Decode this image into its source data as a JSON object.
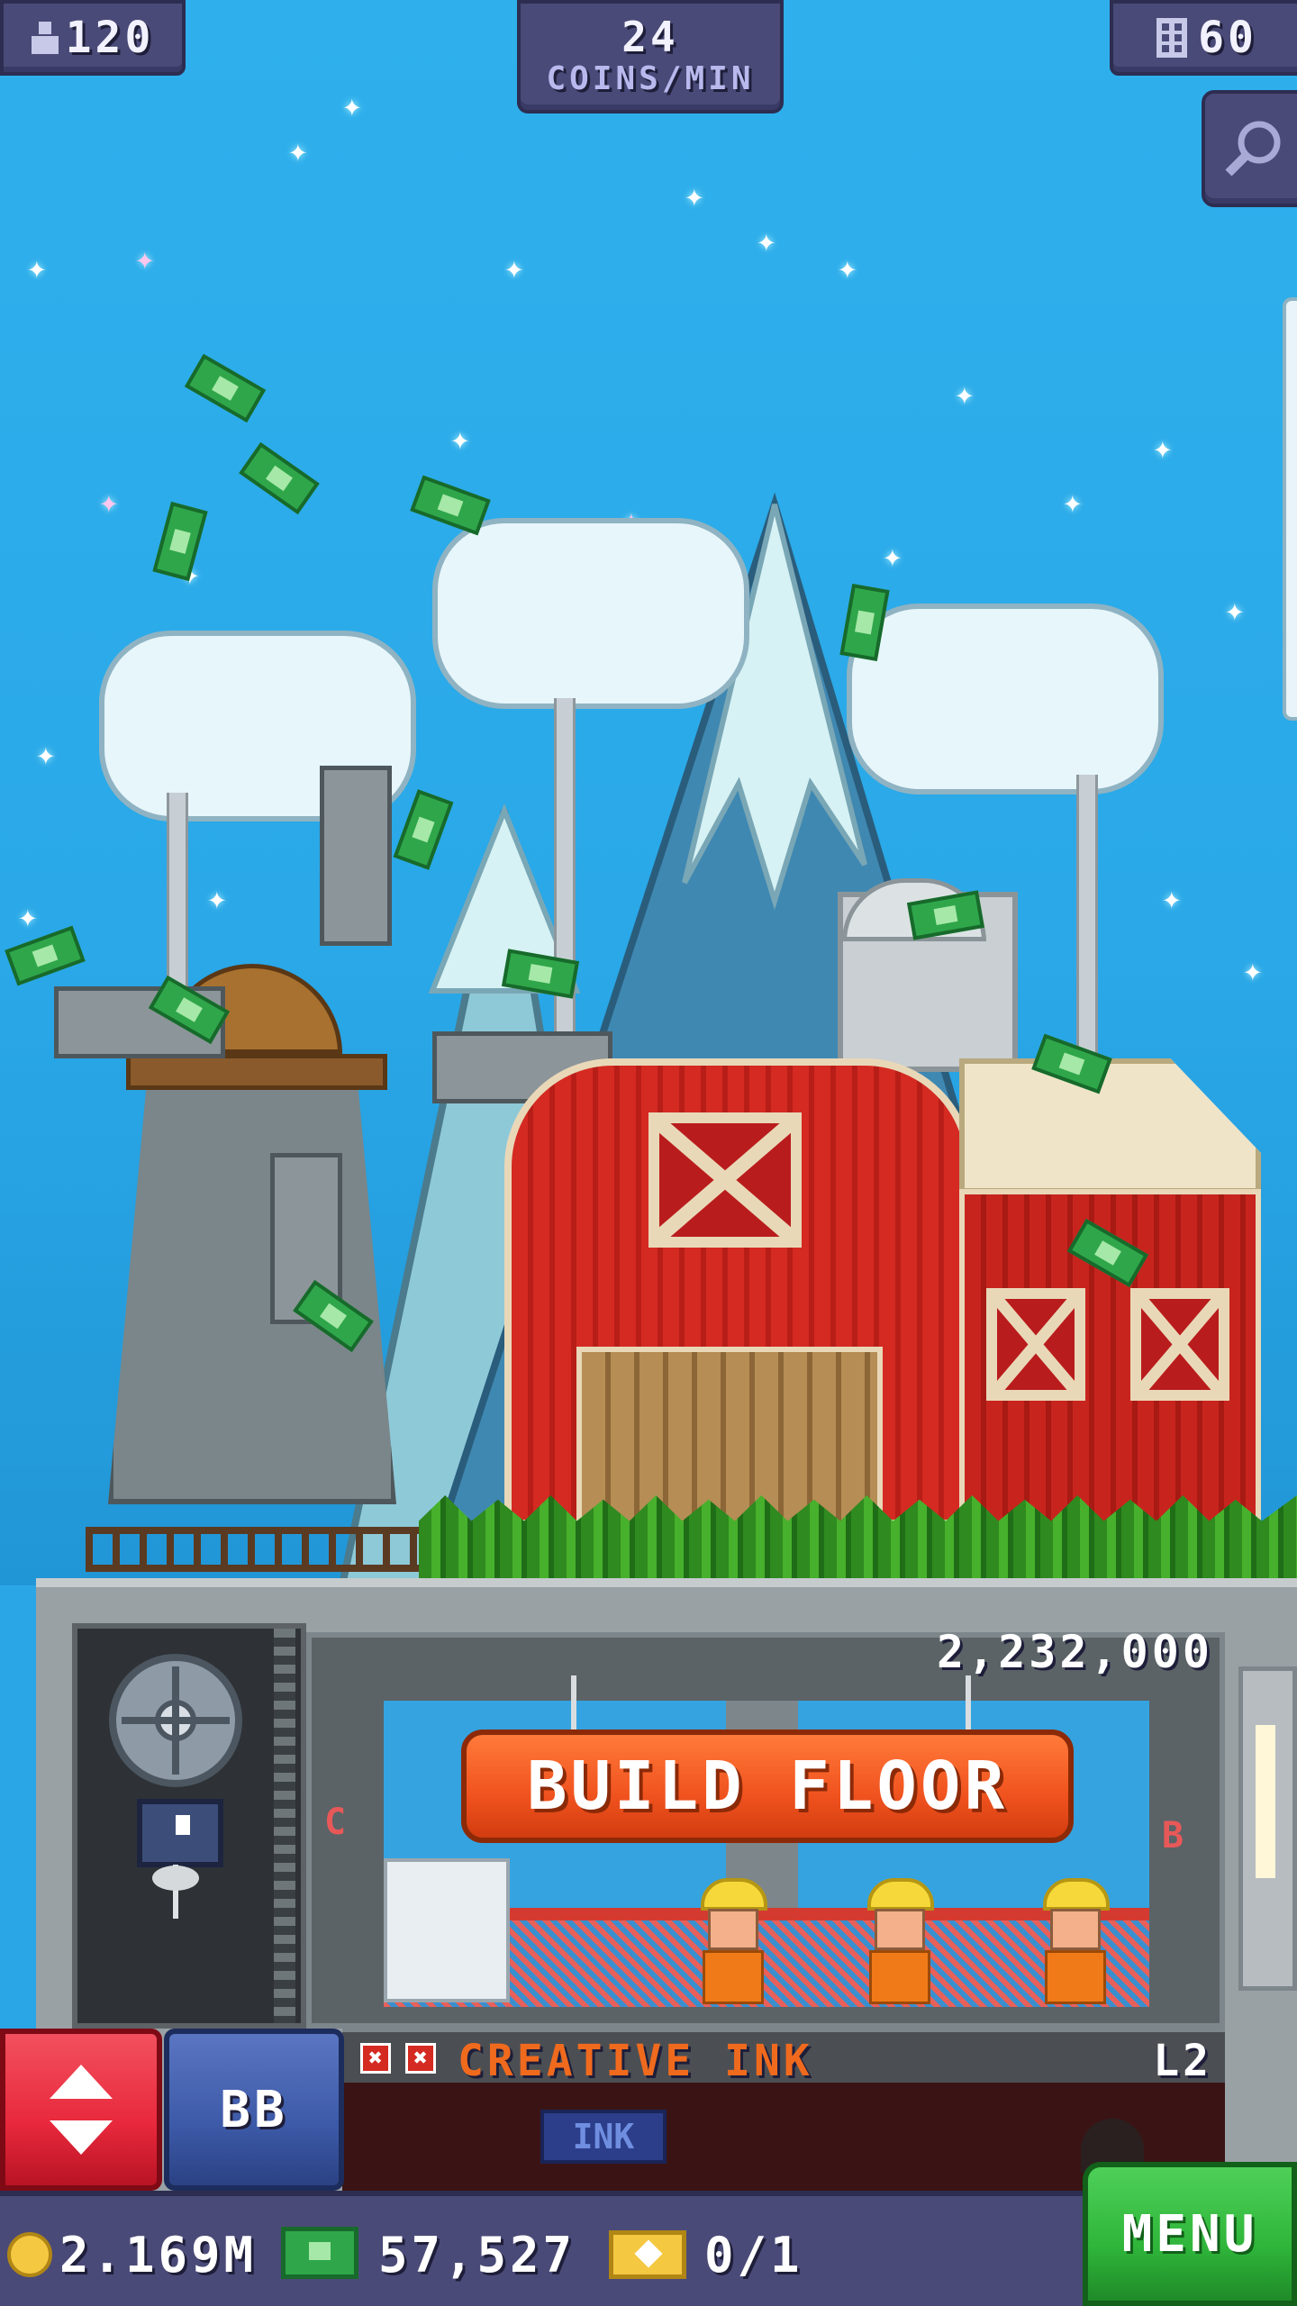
{
  "hud": {
    "population": "120",
    "coins_rate_value": "24",
    "coins_rate_unit": "COINS/MIN",
    "floors": "60"
  },
  "build": {
    "cost": "2,232,000",
    "button_label": "BUILD FLOOR",
    "left_marker": "C",
    "right_marker": "B"
  },
  "floor": {
    "name": "CREATIVE INK",
    "level": "L2",
    "sign_text": "INK"
  },
  "controls": {
    "bb_label": "BB"
  },
  "bottom_bar": {
    "coins": "2.169M",
    "bux": "57,527",
    "tickets": "0/1",
    "menu_label": "MENU"
  },
  "colors": {
    "sky": "#2aa6e6",
    "barn_red": "#d42a22",
    "build_button": "#f0521e",
    "menu_green": "#2fb53a",
    "elevator_button": "#e8283c",
    "bb_button": "#3d5aa8",
    "hud_panel": "#4a4a78",
    "floor_name": "#f06a1e"
  },
  "icons": [
    "person-icon",
    "building-icon",
    "zoom-icon",
    "elevator-arrows-icon",
    "coin-icon",
    "bux-icon",
    "ticket-icon"
  ]
}
